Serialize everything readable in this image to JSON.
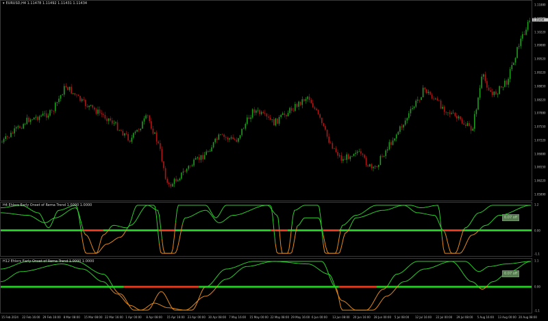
{
  "chart": {
    "symbol": "EURUSD,H4",
    "ohlc": "1.11478 1.11492 1.11431 1.11434",
    "current_price": "1.11434",
    "price_ticks": [
      "1.11880",
      "1.10880",
      "1.10220",
      "1.09880",
      "1.09520",
      "1.09220",
      "1.08850",
      "1.08220",
      "1.07880",
      "1.07550",
      "1.07220",
      "1.06880",
      "1.06550",
      "1.06220",
      "1.05890"
    ],
    "colors": {
      "bull": "#1fa01f",
      "bear": "#b01818"
    }
  },
  "indicator1": {
    "title": "H4 Ehlers Early Onset of Rema Trend 1.0000 1.0000",
    "ticks": [
      "1.2",
      "0.00",
      "-1.1"
    ],
    "badge": "0.07 off",
    "colors": {
      "fast": "#2ccf2c",
      "slow": "#e68a1a",
      "up": "#22d122",
      "down": "#ee3a1a"
    }
  },
  "indicator2": {
    "title": "H12 Ehlers Early Onset of Rema Trend 1.0000 1.0000",
    "ticks": [
      "1.1",
      "0.00",
      "-1.1"
    ],
    "badge": "0.07 off"
  },
  "time_axis": [
    "15 Feb 2024",
    "22 Feb 16:00",
    "29 Feb 16:00",
    "8 Mar 08:00",
    "15 Mar 08:00",
    "22 Mar 16:00",
    "1 Apr 00:00",
    "8 Apr 08:00",
    "15 Apr 16:00",
    "23 Apr 00:00",
    "30 Apr 08:00",
    "7 May 16:00",
    "15 May 00:00",
    "22 May 08:00",
    "29 May 16:00",
    "6 Jun 00:00",
    "13 Jun 08:00",
    "20 Jun 16:00",
    "28 Jun 00:00",
    "5 Jul 08:00",
    "12 Jul 16:00",
    "22 Jul 00:00",
    "29 Jul 08:00",
    "5 Aug 16:00",
    "13 Aug 00:00",
    "20 Aug 08:00"
  ]
}
